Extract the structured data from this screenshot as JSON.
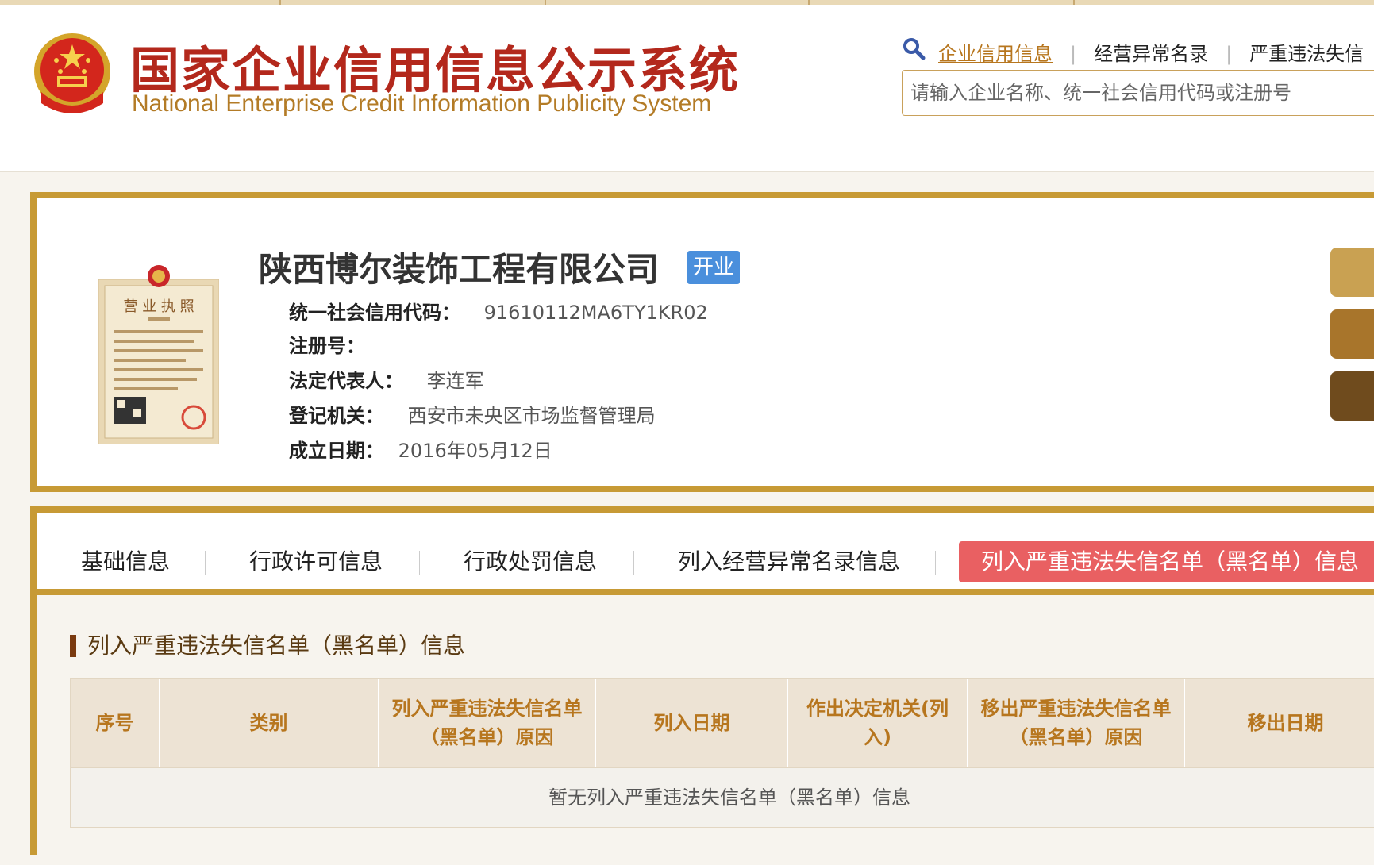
{
  "header": {
    "title_cn": "国家企业信用信息公示系统",
    "title_en": "National Enterprise Credit Information Publicity System",
    "nav": [
      "企业信用信息",
      "经营异常名录",
      "严重违法失信"
    ],
    "search_placeholder": "请输入企业名称、统一社会信用代码或注册号"
  },
  "company": {
    "name": "陕西博尔装饰工程有限公司",
    "status": "开业",
    "license_caption": "营 业 执 照",
    "fields": [
      {
        "label": "统一社会信用代码：",
        "value": "91610112MA6TY1KR02"
      },
      {
        "label": "注册号：",
        "value": ""
      },
      {
        "label": "法定代表人：",
        "value": "李连军"
      },
      {
        "label": "登记机关：",
        "value": "西安市未央区市场监督管理局"
      },
      {
        "label": "成立日期：",
        "value": "2016年05月12日"
      }
    ]
  },
  "tabs": [
    "基础信息",
    "行政许可信息",
    "行政处罚信息",
    "列入经营异常名录信息",
    "列入严重违法失信名单（黑名单）信息"
  ],
  "section": {
    "title": "列入严重违法失信名单（黑名单）信息",
    "columns": [
      "序号",
      "类别",
      "列入严重违法失信名单（黑名单）原因",
      "列入日期",
      "作出决定机关(列入)",
      "移出严重违法失信名单（黑名单）原因",
      "移出日期"
    ],
    "empty_message": "暂无列入严重违法失信名单（黑名单）信息"
  },
  "colors": {
    "brand_red": "#b3281c",
    "gold": "#c79a35",
    "active_tab": "#e96062",
    "status_blue": "#4a8fdc"
  }
}
